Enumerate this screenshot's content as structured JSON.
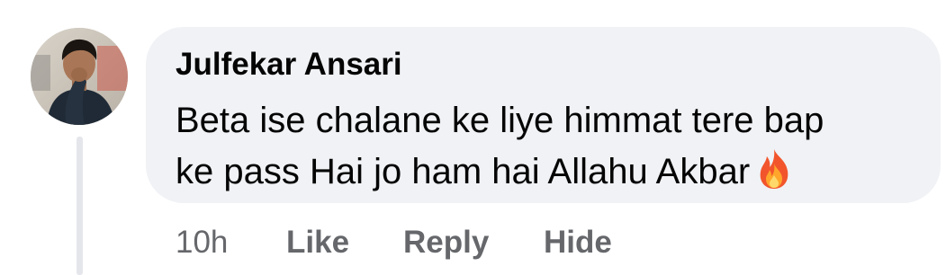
{
  "comment": {
    "author": "Julfekar Ansari",
    "text_line1": "Beta ise chalane ke liye himmat tere bap",
    "text_line2": "ke pass Hai jo ham hai Allahu Akbar",
    "emoji": "fire-icon",
    "avatar": "profile-photo"
  },
  "actions": {
    "time": "10h",
    "like": "Like",
    "reply": "Reply",
    "hide": "Hide"
  },
  "colors": {
    "bubble_bg": "#f0f2f5",
    "text": "#050505",
    "meta_text": "#65676b",
    "thread_line": "#e4e6eb"
  }
}
